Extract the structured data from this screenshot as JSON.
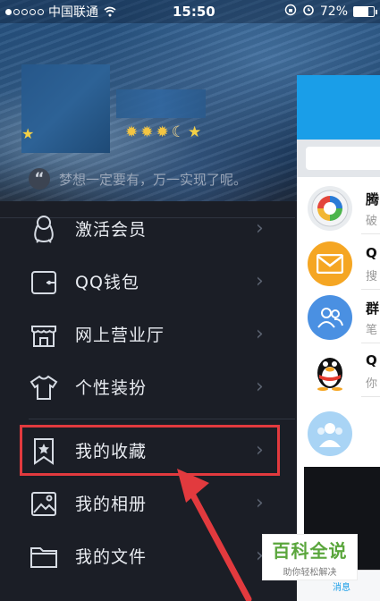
{
  "status_bar": {
    "carrier": "中国联通",
    "time": "15:50",
    "battery": "72%",
    "battery_level": 0.72
  },
  "profile": {
    "signature": "梦想一定要有，万一实现了呢。"
  },
  "menu": {
    "items": [
      {
        "label": "激活会员",
        "icon": "penguin-icon"
      },
      {
        "label": "QQ钱包",
        "icon": "wallet-icon"
      },
      {
        "label": "网上营业厅",
        "icon": "store-icon"
      },
      {
        "label": "个性装扮",
        "icon": "tshirt-icon"
      },
      {
        "label": "我的收藏",
        "icon": "bookmark-star-icon",
        "highlighted": true
      },
      {
        "label": "我的相册",
        "icon": "photo-icon"
      },
      {
        "label": "我的文件",
        "icon": "folder-icon"
      }
    ]
  },
  "chat_pane": {
    "rows": [
      {
        "title": "腾",
        "subtitle": "破"
      },
      {
        "title": "Q",
        "subtitle": "搜"
      },
      {
        "title": "群",
        "subtitle": "笔"
      },
      {
        "title": "Q",
        "subtitle": "你"
      }
    ],
    "tab_label": "消息"
  },
  "watermark": {
    "main": "百科全说",
    "sub": "助你轻松解决"
  },
  "colors": {
    "highlight": "#e23a3e",
    "accent": "#1a9ee8",
    "menu_bg": "#1b1e26"
  }
}
